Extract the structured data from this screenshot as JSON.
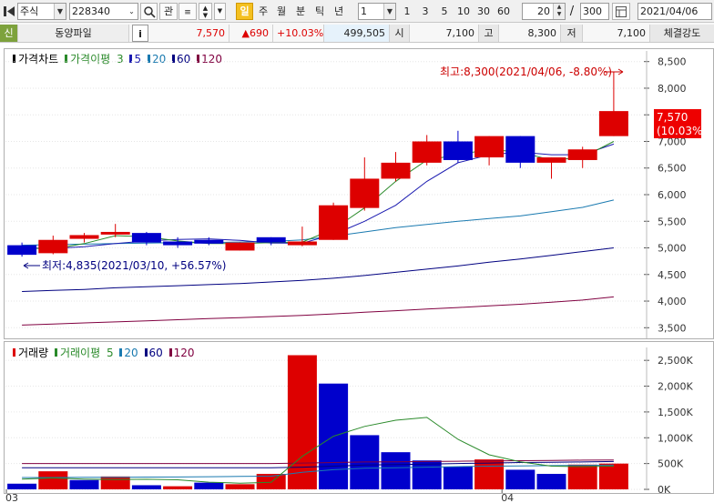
{
  "toolbar": {
    "market": "주식",
    "code": "228340",
    "btn_gwan": "관",
    "btn_il": "일",
    "period_buttons": [
      "주",
      "월",
      "분",
      "틱",
      "년"
    ],
    "unit": "1",
    "interval_buttons": [
      "1",
      "3",
      "5",
      "10",
      "30",
      "60"
    ],
    "count": "20",
    "slash": "/",
    "total": "300",
    "date": "2021/04/06"
  },
  "infobar": {
    "credit_tag": "신",
    "stock_name": "동양파일",
    "info_btn": "i",
    "price": "7,570",
    "change": "▲690",
    "change_pct": "+10.03%",
    "volume": "499,505",
    "open_label": "시",
    "open": "7,100",
    "high_label": "고",
    "high": "8,300",
    "low_label": "저",
    "low": "7,100",
    "strength_label": "체결강도"
  },
  "price_panel": {
    "legend": [
      {
        "text": "가격차트",
        "color": "#000000"
      },
      {
        "text": "가격이평",
        "color": "#2a8a2a"
      },
      {
        "text": "3",
        "color": "#2a8a2a"
      },
      {
        "text": "5",
        "color": "#1a1ab0"
      },
      {
        "text": "20",
        "color": "#1a7ab0"
      },
      {
        "text": "60",
        "color": "#000080"
      },
      {
        "text": "120",
        "color": "#800040"
      }
    ],
    "high_annotation": "최고:8,300(2021/04/06, -8.80%)",
    "low_annotation": "최저:4,835(2021/03/10, +56.57%)",
    "last_price_tag": "7,570",
    "last_pct_tag": "(10.03%)"
  },
  "volume_panel": {
    "legend": [
      {
        "text": "거래량",
        "color": "#000000"
      },
      {
        "text": "거래이평",
        "color": "#2a8a2a"
      },
      {
        "text": "5",
        "color": "#2a8a2a"
      },
      {
        "text": "20",
        "color": "#1a7ab0"
      },
      {
        "text": "60",
        "color": "#000080"
      },
      {
        "text": "120",
        "color": "#800040"
      }
    ]
  },
  "x_labels": [
    "03",
    "04"
  ],
  "colors": {
    "up": "#dd0000",
    "down": "#0000cc",
    "ma3": "#2a8a2a",
    "ma5": "#1a1ab0",
    "ma20": "#1a7ab0",
    "ma60": "#000080",
    "ma120": "#800040"
  },
  "chart_data": [
    {
      "type": "candlestick",
      "title": "가격차트",
      "ylim": [
        3300,
        8700
      ],
      "yticks": [
        3500,
        4000,
        4500,
        5000,
        5500,
        6000,
        6500,
        7000,
        7500,
        8000,
        8500
      ],
      "candles": [
        {
          "o": 5050,
          "h": 5100,
          "l": 4835,
          "c": 4870
        },
        {
          "o": 4900,
          "h": 5230,
          "l": 4880,
          "c": 5150
        },
        {
          "o": 5170,
          "h": 5280,
          "l": 5100,
          "c": 5240
        },
        {
          "o": 5250,
          "h": 5450,
          "l": 5200,
          "c": 5300
        },
        {
          "o": 5280,
          "h": 5300,
          "l": 5050,
          "c": 5100
        },
        {
          "o": 5120,
          "h": 5200,
          "l": 5000,
          "c": 5050
        },
        {
          "o": 5150,
          "h": 5200,
          "l": 5050,
          "c": 5080
        },
        {
          "o": 4950,
          "h": 5100,
          "l": 4950,
          "c": 5100
        },
        {
          "o": 5200,
          "h": 5200,
          "l": 5050,
          "c": 5100
        },
        {
          "o": 5050,
          "h": 5400,
          "l": 5030,
          "c": 5120
        },
        {
          "o": 5150,
          "h": 5850,
          "l": 5150,
          "c": 5800
        },
        {
          "o": 5750,
          "h": 6700,
          "l": 5700,
          "c": 6300
        },
        {
          "o": 6300,
          "h": 6800,
          "l": 6250,
          "c": 6600
        },
        {
          "o": 6600,
          "h": 7120,
          "l": 6550,
          "c": 7000
        },
        {
          "o": 7000,
          "h": 7200,
          "l": 6600,
          "c": 6650
        },
        {
          "o": 6700,
          "h": 7100,
          "l": 6550,
          "c": 7100
        },
        {
          "o": 7100,
          "h": 7100,
          "l": 6500,
          "c": 6600
        },
        {
          "o": 6600,
          "h": 6700,
          "l": 6300,
          "c": 6700
        },
        {
          "o": 6650,
          "h": 6900,
          "l": 6500,
          "c": 6850
        },
        {
          "o": 7100,
          "h": 8300,
          "l": 7100,
          "c": 7570
        }
      ],
      "ma3": [
        5000,
        4980,
        5080,
        5230,
        5210,
        5130,
        5080,
        5080,
        5100,
        5110,
        5350,
        5750,
        6250,
        6650,
        6750,
        6850,
        6800,
        6650,
        6700,
        7000
      ],
      "ma5": [
        5000,
        4990,
        5020,
        5080,
        5130,
        5160,
        5170,
        5140,
        5090,
        5090,
        5250,
        5500,
        5800,
        6250,
        6600,
        6750,
        6800,
        6750,
        6750,
        6950
      ],
      "ma20": [
        5050,
        5060,
        5070,
        5080,
        5090,
        5100,
        5100,
        5110,
        5120,
        5150,
        5220,
        5300,
        5380,
        5440,
        5500,
        5550,
        5600,
        5680,
        5760,
        5900
      ],
      "ma60": [
        4180,
        4200,
        4220,
        4250,
        4270,
        4290,
        4310,
        4330,
        4360,
        4390,
        4430,
        4480,
        4540,
        4600,
        4660,
        4730,
        4790,
        4860,
        4930,
        5000
      ],
      "ma120": [
        3550,
        3570,
        3590,
        3610,
        3630,
        3650,
        3670,
        3690,
        3710,
        3730,
        3760,
        3790,
        3820,
        3850,
        3880,
        3910,
        3940,
        3980,
        4020,
        4080
      ],
      "high_point": {
        "value": 8300,
        "date": "2021/04/06"
      },
      "low_point": {
        "value": 4835,
        "date": "2021/03/10"
      }
    },
    {
      "type": "bar",
      "title": "거래량",
      "ylim": [
        0,
        2750000
      ],
      "yticks": [
        0,
        500000,
        1000000,
        1500000,
        2000000,
        2500000
      ],
      "ytick_labels": [
        "0K",
        "500K",
        "1,000K",
        "1,500K",
        "2,000K",
        "2,500K"
      ],
      "values": [
        110000,
        350000,
        180000,
        250000,
        80000,
        60000,
        130000,
        100000,
        300000,
        2600000,
        2050000,
        1050000,
        720000,
        560000,
        440000,
        580000,
        380000,
        300000,
        480000,
        499505
      ],
      "directions": [
        "down",
        "up",
        "down",
        "up",
        "down",
        "up",
        "down",
        "up",
        "up",
        "up",
        "down",
        "down",
        "down",
        "down",
        "down",
        "up",
        "down",
        "down",
        "up",
        "up"
      ],
      "ma5": [
        200000,
        220000,
        200000,
        190000,
        195000,
        185000,
        140000,
        120000,
        135000,
        640000,
        1030000,
        1220000,
        1340000,
        1395000,
        970000,
        670000,
        535000,
        450000,
        440000,
        450000
      ],
      "ma20": [
        230000,
        230000,
        232000,
        235000,
        238000,
        240000,
        245000,
        250000,
        255000,
        330000,
        380000,
        410000,
        420000,
        430000,
        440000,
        450000,
        455000,
        460000,
        465000,
        470000
      ],
      "ma60": [
        420000,
        420000,
        420000,
        420000,
        420000,
        420000,
        420000,
        420000,
        420000,
        430000,
        450000,
        470000,
        480000,
        490000,
        500000,
        510000,
        520000,
        525000,
        530000,
        540000
      ],
      "ma120": [
        500000,
        500000,
        500000,
        500000,
        500000,
        500000,
        500000,
        500000,
        500000,
        510000,
        520000,
        530000,
        535000,
        540000,
        545000,
        550000,
        555000,
        560000,
        565000,
        570000
      ],
      "x_labels": [
        {
          "index": 0,
          "text": "03"
        },
        {
          "index": 16,
          "text": "04"
        }
      ]
    }
  ]
}
